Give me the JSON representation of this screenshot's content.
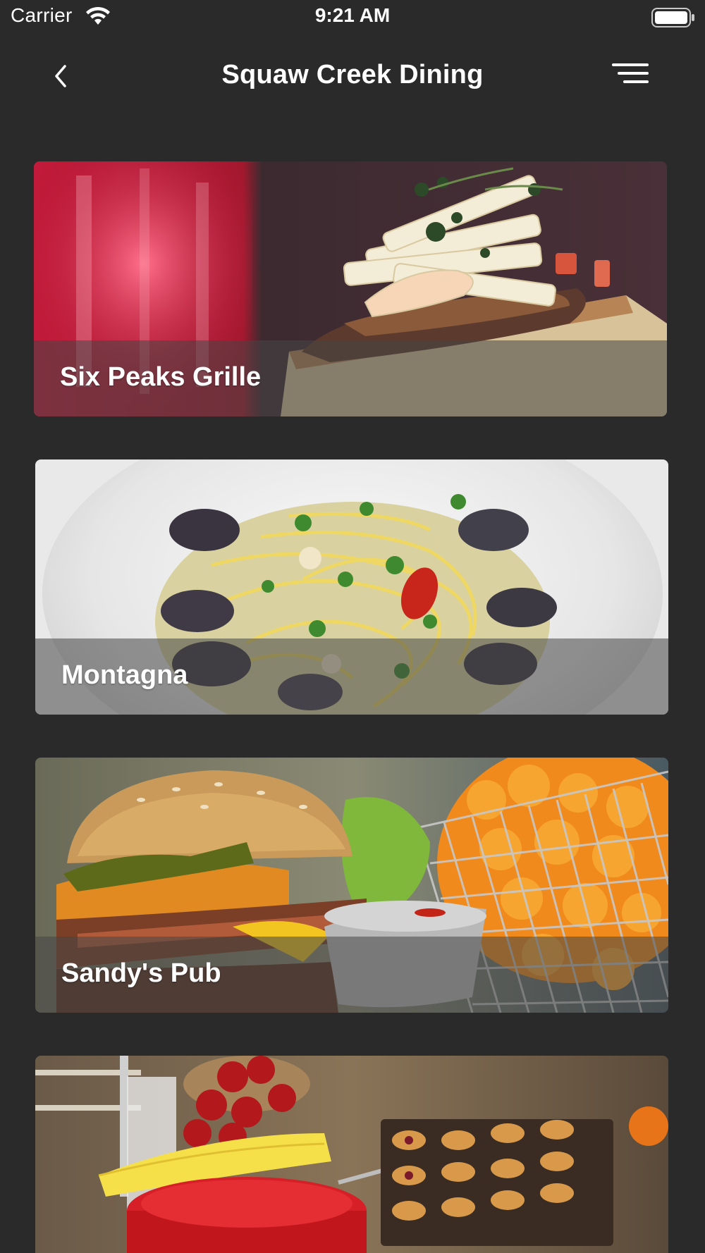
{
  "status_bar": {
    "carrier": "Carrier",
    "time": "9:21 AM",
    "icons": [
      "wifi-icon",
      "battery-icon"
    ]
  },
  "nav": {
    "title": "Squaw Creek Dining",
    "back_icon": "chevron-left-icon",
    "menu_icon": "menu-icon"
  },
  "restaurants": [
    {
      "name": "Six Peaks Grille",
      "image": "plated-appetizer-photo"
    },
    {
      "name": "Montagna",
      "image": "pasta-clams-photo"
    },
    {
      "name": "Sandy's Pub",
      "image": "burger-fries-photo"
    },
    {
      "name": "",
      "image": "breakfast-buffet-photo"
    }
  ],
  "colors": {
    "background": "#2a2a2b",
    "text": "#ffffff",
    "overlay": "rgba(70,70,70,0.55)"
  }
}
